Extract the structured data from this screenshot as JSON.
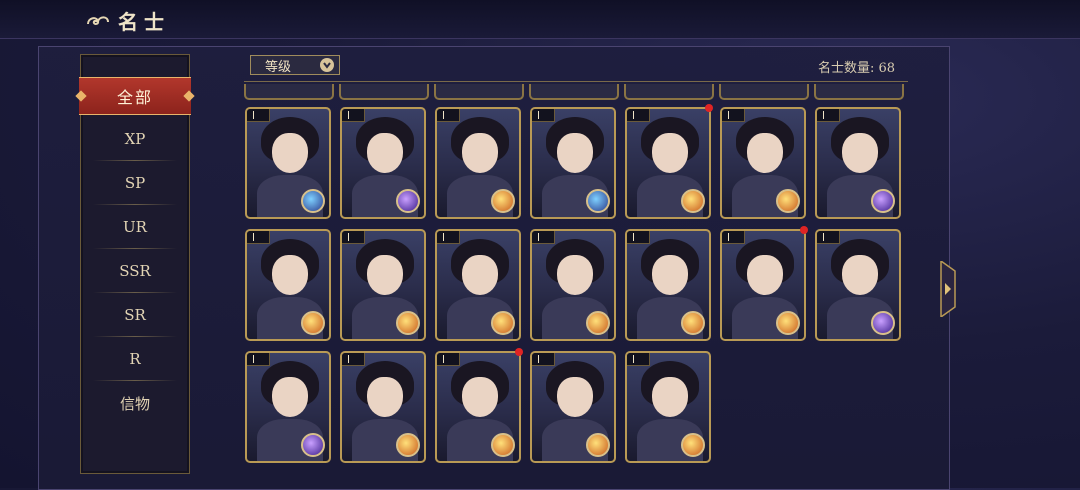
{
  "header": {
    "title": "名士",
    "logo_icon": "cloud-swirl-icon"
  },
  "sidebar": {
    "active": "全部",
    "items": [
      "XP",
      "SP",
      "UR",
      "SSR",
      "SR",
      "R",
      "信物"
    ]
  },
  "filter": {
    "label": "等级",
    "icon": "chevron-down-icon"
  },
  "roster": {
    "count_text": "名士数量: 68"
  },
  "cards": [
    {
      "orb": "blue"
    },
    {
      "orb": "purple"
    },
    {
      "orb": "gold"
    },
    {
      "orb": "blue"
    },
    {
      "orb": "gold",
      "dot": true
    },
    {
      "orb": "gold"
    },
    {
      "orb": "purple"
    },
    {
      "orb": "gold"
    },
    {
      "orb": "gold"
    },
    {
      "orb": "gold"
    },
    {
      "orb": "gold"
    },
    {
      "orb": "gold"
    },
    {
      "orb": "gold",
      "dot": true
    },
    {
      "orb": "purple"
    },
    {
      "orb": "purple"
    },
    {
      "orb": "gold"
    },
    {
      "orb": "gold",
      "dot": true
    },
    {
      "orb": "gold"
    },
    {
      "orb": "gold"
    }
  ],
  "colors": {
    "accent_red": "#b2372c",
    "gold_border": "#b99a55",
    "notification_dot": "#e02424"
  }
}
